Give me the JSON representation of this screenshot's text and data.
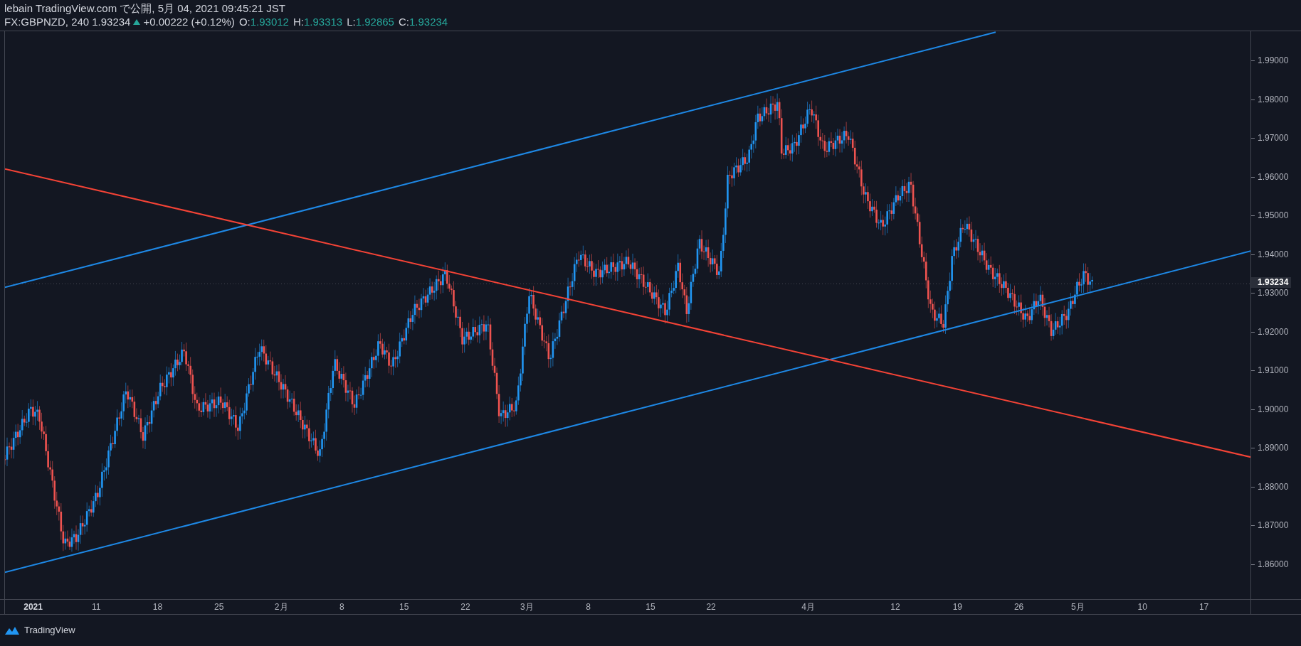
{
  "header": {
    "title": "lebain TradingView.com で公開, 5月 04, 2021 09:45:21 JST",
    "symbol": "FX:GBPNZD, 240",
    "last": "1.93234",
    "up": true,
    "change": "+0.00222 (+0.12%)",
    "ohlc": [
      {
        "label": "O:",
        "value": "1.93012"
      },
      {
        "label": "H:",
        "value": "1.93313"
      },
      {
        "label": "L:",
        "value": "1.92865"
      },
      {
        "label": "C:",
        "value": "1.93234"
      }
    ]
  },
  "price_axis": {
    "labels": [
      "1.99000",
      "1.98000",
      "1.97000",
      "1.96000",
      "1.95000",
      "1.94000",
      "1.93000",
      "1.92000",
      "1.91000",
      "1.90000",
      "1.89000",
      "1.88000",
      "1.87000",
      "1.86000"
    ],
    "last_price_tag": "1.93234"
  },
  "time_axis": {
    "labels": [
      "2021",
      "11",
      "18",
      "25",
      "2月",
      "8",
      "15",
      "22",
      "3月",
      "8",
      "15",
      "22",
      "4月",
      "12",
      "19",
      "26",
      "5月",
      "10",
      "17"
    ]
  },
  "footer": {
    "logo_text": "TradingView"
  }
}
